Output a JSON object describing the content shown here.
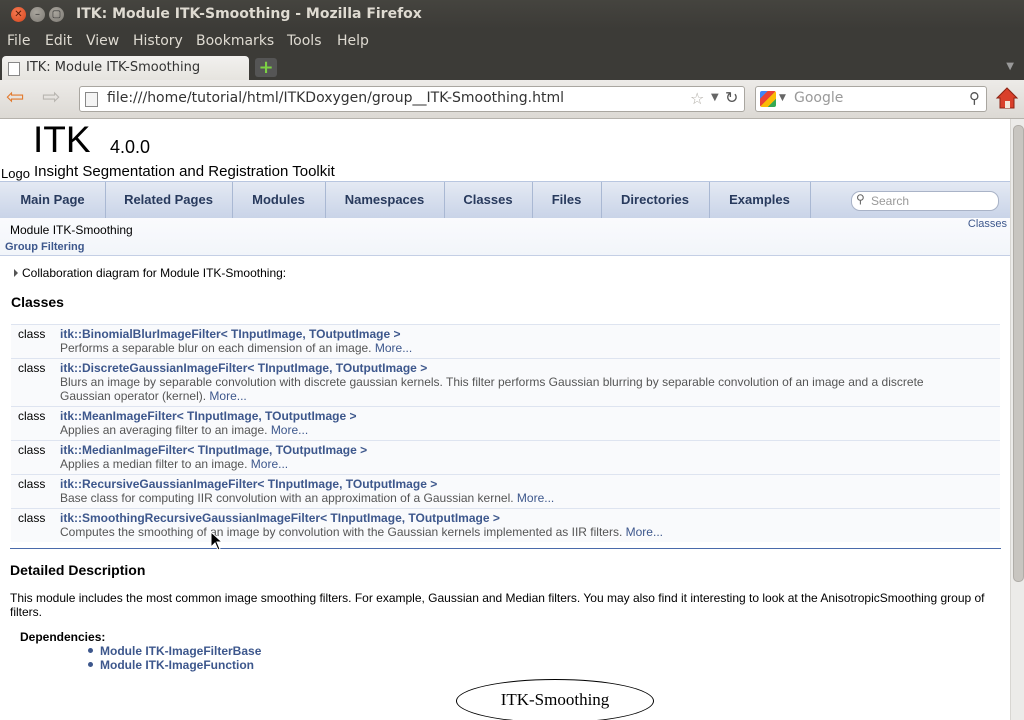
{
  "window": {
    "title": "ITK: Module ITK-Smoothing - Mozilla Firefox",
    "close_glyph": "✕",
    "min_glyph": "–",
    "max_glyph": "▢"
  },
  "menu": [
    "File",
    "Edit",
    "View",
    "History",
    "Bookmarks",
    "Tools",
    "Help"
  ],
  "tab": {
    "label": "ITK: Module ITK-Smoothing",
    "new_tab_glyph": "+",
    "list_glyph": "▼"
  },
  "nav": {
    "back_glyph": "⇦",
    "forward_glyph": "⇨",
    "url": "file:///home/tutorial/html/ITKDoxygen/group__ITK-Smoothing.html",
    "star_glyph": "☆",
    "dropdown_glyph": "▼",
    "reload_glyph": "↻",
    "search_engine_drop": "▼",
    "search_placeholder": "Google",
    "search_glyph": "⚲"
  },
  "page": {
    "project_name": "ITK",
    "project_number": "4.0.0",
    "logo_alt": "Logo",
    "project_brief": "Insight Segmentation and Registration Toolkit",
    "navtabs": [
      "Main Page",
      "Related Pages",
      "Modules",
      "Namespaces",
      "Classes",
      "Files",
      "Directories",
      "Examples"
    ],
    "search_placeholder": "Search",
    "search_glyph": "⚲",
    "module_title": "Module ITK-Smoothing",
    "group_filter": "Group Filtering",
    "summary_link": "Classes",
    "collab_text": "Collaboration diagram for Module ITK-Smoothing:",
    "classes_heading": "Classes",
    "classes": [
      {
        "kw": "class",
        "name": "itk::BinomialBlurImageFilter< TInputImage, TOutputImage >",
        "desc": "Performs a separable blur on each dimension of an image.",
        "more": "More..."
      },
      {
        "kw": "class",
        "name": "itk::DiscreteGaussianImageFilter< TInputImage, TOutputImage >",
        "desc": "Blurs an image by separable convolution with discrete gaussian kernels. This filter performs Gaussian blurring by separable convolution of an image and a discrete Gaussian operator (kernel).",
        "more": "More..."
      },
      {
        "kw": "class",
        "name": "itk::MeanImageFilter< TInputImage, TOutputImage >",
        "desc": "Applies an averaging filter to an image.",
        "more": "More..."
      },
      {
        "kw": "class",
        "name": "itk::MedianImageFilter< TInputImage, TOutputImage >",
        "desc": "Applies a median filter to an image.",
        "more": "More..."
      },
      {
        "kw": "class",
        "name": "itk::RecursiveGaussianImageFilter< TInputImage, TOutputImage >",
        "desc": "Base class for computing IIR convolution with an approximation of a Gaussian kernel.",
        "more": "More..."
      },
      {
        "kw": "class",
        "name": "itk::SmoothingRecursiveGaussianImageFilter< TInputImage, TOutputImage >",
        "desc": "Computes the smoothing of an image by convolution with the Gaussian kernels implemented as IIR filters.",
        "more": "More..."
      }
    ],
    "detail_heading": "Detailed Description",
    "detail_text": "This module includes the most common image smoothing filters. For example, Gaussian and Median filters. You may also find it interesting to look at the AnisotropicSmoothing group of filters.",
    "deps_heading": "Dependencies:",
    "dependencies": [
      "Module ITK-ImageFilterBase",
      "Module ITK-ImageFunction"
    ],
    "diagram_label": "ITK-Smoothing"
  },
  "colors": {
    "link": "#3d578c",
    "chrome_dark": "#3c3b37",
    "nav_bg": "#c9d4e8"
  }
}
